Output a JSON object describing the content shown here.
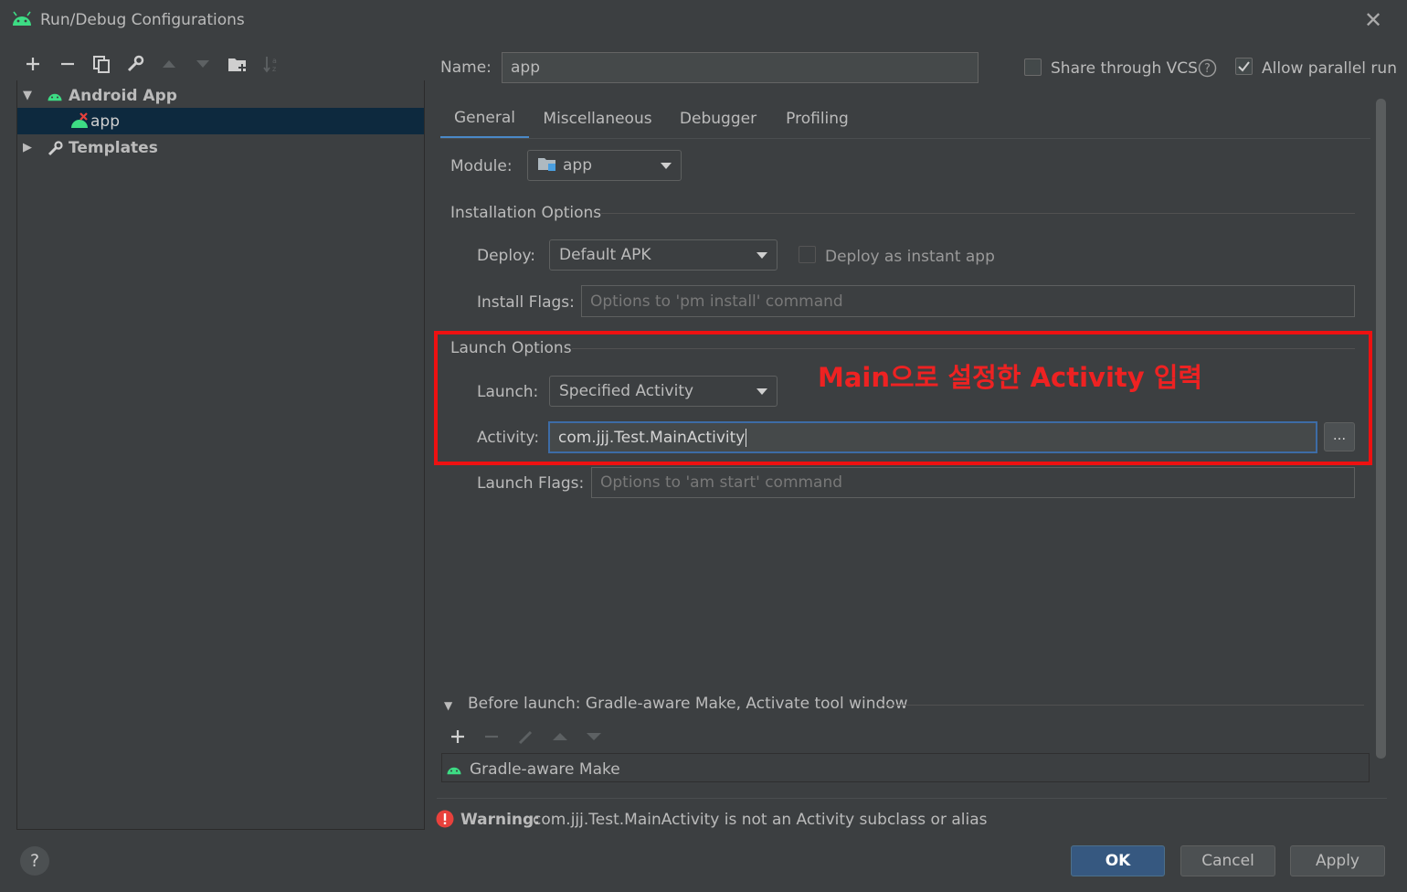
{
  "window": {
    "title": "Run/Debug Configurations",
    "close_glyph": "✕"
  },
  "toolbar": {
    "icons": [
      "add-icon",
      "remove-icon",
      "copy-icon",
      "wrench-icon",
      "move-up-icon",
      "move-down-icon",
      "new-folder-icon",
      "sort-icon"
    ]
  },
  "tree": {
    "group_label": "Android App",
    "selected_item": "app",
    "templates_label": "Templates"
  },
  "config": {
    "name_label": "Name:",
    "name_value": "app",
    "share_vcs_label": "Share through VCS",
    "share_vcs_checked": false,
    "allow_parallel_label": "Allow parallel run",
    "allow_parallel_checked": true
  },
  "tabs": [
    "General",
    "Miscellaneous",
    "Debugger",
    "Profiling"
  ],
  "active_tab": "General",
  "module": {
    "label": "Module:",
    "value": "app"
  },
  "installation": {
    "section_title": "Installation Options",
    "deploy_label": "Deploy:",
    "deploy_value": "Default APK",
    "instant_app_label": "Deploy as instant app",
    "install_flags_label": "Install Flags:",
    "install_flags_placeholder": "Options to 'pm install' command"
  },
  "launch": {
    "section_title": "Launch Options",
    "launch_label": "Launch:",
    "launch_value": "Specified Activity",
    "activity_label": "Activity:",
    "activity_value": "com.jjj.Test.MainActivity",
    "browse_label": "...",
    "launch_flags_label": "Launch Flags:",
    "launch_flags_placeholder": "Options to 'am start' command"
  },
  "annotation": {
    "text": "Main으로 설정한 Activity 입력",
    "color": "#ee2222"
  },
  "before_launch": {
    "header": "Before launch: Gradle-aware Make, Activate tool window",
    "task": "Gradle-aware Make"
  },
  "warning": {
    "prefix": "Warning:",
    "message": "com.jjj.Test.MainActivity is not an Activity subclass or alias"
  },
  "buttons": {
    "ok": "OK",
    "cancel": "Cancel",
    "apply": "Apply",
    "help": "?"
  },
  "colors": {
    "background": "#3c3f41",
    "selection": "#0d293e",
    "accent": "#4a88c7",
    "android_green": "#3ddc84",
    "highlight_red": "#ee1111"
  }
}
